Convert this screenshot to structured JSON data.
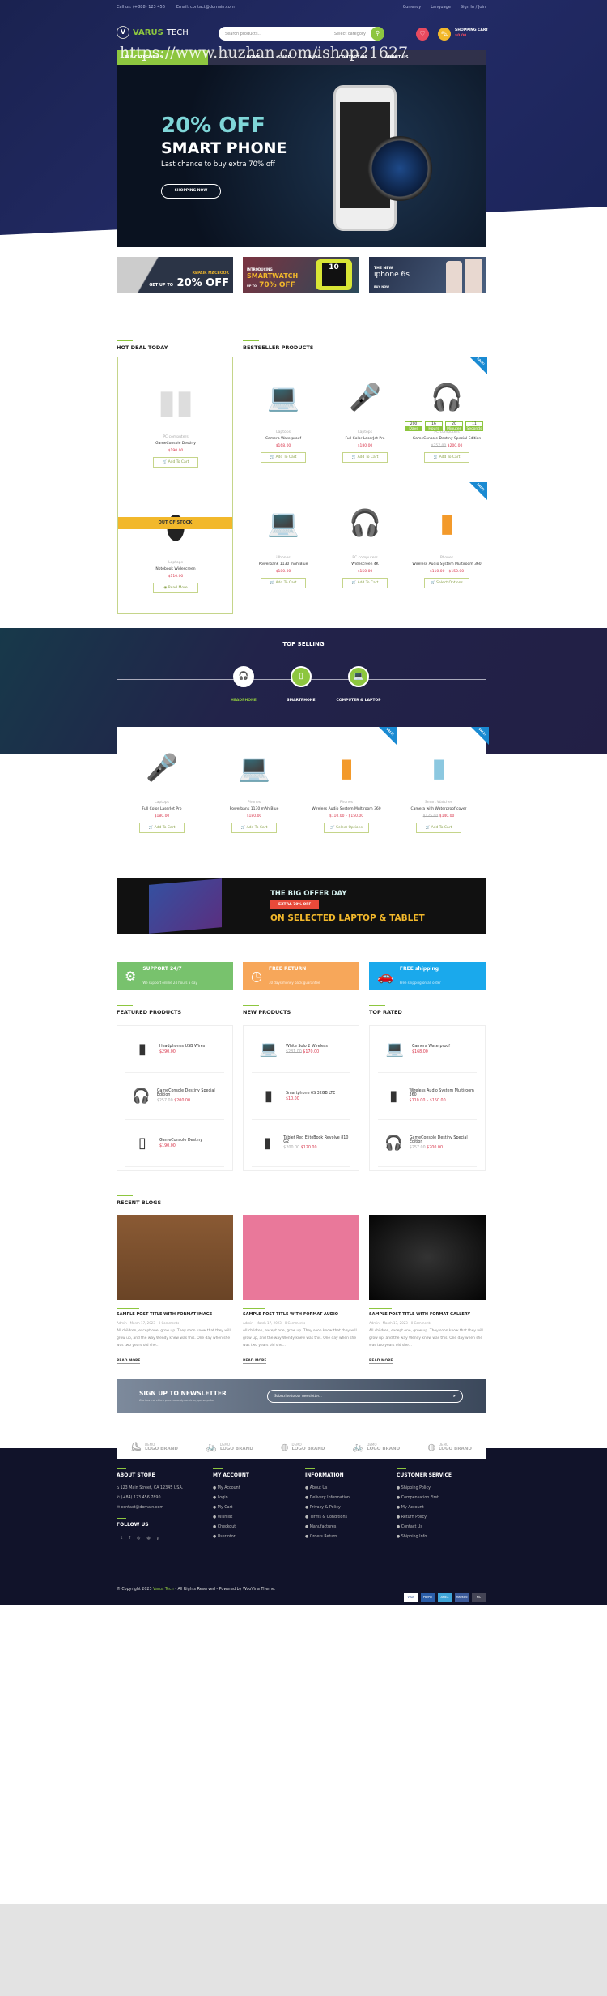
{
  "watermark": "https://www.huzhan.com/ishop21627",
  "topbar": {
    "phone": "Call us: (+888) 123 456",
    "email": "Email: contact@domain.com",
    "currency": "Currency",
    "language": "Language",
    "signin": "Sign In / Join"
  },
  "header": {
    "logo_a": "VARUS",
    "logo_b": "TECH",
    "search_placeholder": "Search products...",
    "category": "Select category",
    "cart_label": "SHOPPING CART",
    "cart_total": "$0.00",
    "wishlist_count": "0",
    "cart_count": "0"
  },
  "nav": {
    "all": "ALL CATEGORIES",
    "items": [
      "HOME",
      "SHOP",
      "BLOG",
      "CONTACT US",
      "ABOUT US"
    ]
  },
  "hero": {
    "line1": "20% OFF",
    "line2": "SMART PHONE",
    "line3": "Last chance to buy extra 70% off",
    "button": "SHOPPING NOW"
  },
  "promos": [
    {
      "small": "REPAIR MACBOOK",
      "a": "GET UP TO",
      "b": "20% OFF"
    },
    {
      "small": "INTRODUCING",
      "a": "SMARTWATCH",
      "b": "UP TO",
      "c": "70% OFF"
    },
    {
      "small": "THE NEW",
      "a": "iphone 6s",
      "b": "BUY NOW"
    }
  ],
  "hot_deal": {
    "title": "HOT DEAL TODAY",
    "items": [
      {
        "cat": "PC computers",
        "name": "GameConsole Destiny",
        "price": "$190.00",
        "btn": "Add To Cart"
      },
      {
        "cat": "Laptops",
        "name": "Notebook Widescreen",
        "price": "$110.00",
        "btn": "Read More",
        "badge": "OUT OF STOCK"
      }
    ]
  },
  "bestseller": {
    "title": "BESTSELLER PRODUCTS",
    "items": [
      {
        "cat": "Laptops",
        "name": "Camera Waterproof",
        "price": "$168.00",
        "btn": "Add To Cart"
      },
      {
        "cat": "Laptops",
        "name": "Full Color LaserJet Pro",
        "price": "$180.00",
        "btn": "Add To Cart"
      },
      {
        "cat": "PC computers",
        "name": "GameConsole Destiny Special Edition",
        "old": "$257.00",
        "price": "$200.00",
        "btn": "Add To Cart",
        "sale": "SALE!"
      },
      {
        "cat": "iPhones",
        "name": "Powerbank 1130 mAh Blue",
        "price": "$180.00",
        "btn": "Add To Cart"
      },
      {
        "cat": "PC computers",
        "name": "Widescreen 4K",
        "price": "$150.00",
        "btn": "Add To Cart"
      },
      {
        "cat": "Phones",
        "name": "Wireless Audio System Multiroom 360",
        "price": "$110.00 – $150.00",
        "btn": "Select Options",
        "sale": "SALE!"
      }
    ],
    "countdown": [
      {
        "v": "200",
        "l": "Days"
      },
      {
        "v": "16",
        "l": "Hours"
      },
      {
        "v": "20",
        "l": "Minutes"
      },
      {
        "v": "11",
        "l": "Seconds"
      }
    ]
  },
  "top_selling": {
    "title": "TOP SELLING",
    "tabs": [
      "HEADPHONE",
      "SMARTPHONE",
      "COMPUTER & LAPTOP"
    ],
    "items": [
      {
        "cat": "Laptops",
        "name": "Full Color LaserJet Pro",
        "price": "$180.00",
        "btn": "Add To Cart"
      },
      {
        "cat": "Phones",
        "name": "Powerbank 1130 mAh Blue",
        "price": "$180.00",
        "btn": "Add To Cart"
      },
      {
        "cat": "Phones",
        "name": "Wireless Audio System Multiroom 360",
        "price": "$110.00 – $150.00",
        "btn": "Select Options",
        "sale": "SALE!"
      },
      {
        "cat": "Smart Watches",
        "name": "Camera with Waterproof cover",
        "old": "$175.00",
        "price": "$140.00",
        "btn": "Add To Cart",
        "sale": "SALE!"
      }
    ]
  },
  "offer": {
    "line1": "THE BIG OFFER DAY",
    "badge": "EXTRA 70% OFF",
    "line2": "ON SELECTED LAPTOP & TABLET"
  },
  "services": [
    {
      "t": "SUPPORT 24/7",
      "s": "We support online 24 hours a day",
      "c": "#78c26d"
    },
    {
      "t": "FREE RETURN",
      "s": "30 days money back guarantee",
      "c": "#f7a75a"
    },
    {
      "t": "FREE shipping",
      "s": "Free shipping on all order",
      "c": "#1aa9ec"
    }
  ],
  "lists": [
    {
      "title": "FEATURED PRODUCTS",
      "items": [
        {
          "n": "Headphones USB Wires",
          "p": "$290.00"
        },
        {
          "n": "GameConsole Destiny Special Edition",
          "o": "$257.00",
          "p": "$200.00"
        },
        {
          "n": "GameConsole Destiny",
          "p": "$190.00"
        }
      ]
    },
    {
      "title": "NEW PRODUCTS",
      "items": [
        {
          "n": "White Solo 2 Wireless",
          "o": "$281.00",
          "p": "$170.00"
        },
        {
          "n": "Smartphone 6S 32GB LTE",
          "p": "$10.00"
        },
        {
          "n": "Tablet Red EliteBook Revolve 810 G2",
          "o": "$200.00",
          "p": "$120.00"
        }
      ]
    },
    {
      "title": "TOP RATED",
      "items": [
        {
          "n": "Camera Waterproof",
          "p": "$168.00"
        },
        {
          "n": "Wireless Audio System Multiroom 360",
          "p": "$110.00 – $150.00"
        },
        {
          "n": "GameConsole Destiny Special Edition",
          "o": "$257.00",
          "p": "$200.00"
        }
      ]
    }
  ],
  "blogs": {
    "title": "RECENT BLOGS",
    "items": [
      {
        "t": "SAMPLE POST TITLE WITH FORMAT IMAGE",
        "a": "Admin",
        "d": "March 17, 2023",
        "c": "0 Comments",
        "x": "All children, except one, grow up. They soon know that they will grow up, and the way Wendy knew was this. One day when she was two years old she...",
        "r": "READ MORE"
      },
      {
        "t": "SAMPLE POST TITLE WITH FORMAT AUDIO",
        "a": "Admin",
        "d": "March 17, 2023",
        "c": "0 Comments",
        "x": "All children, except one, grow up. They soon know that they will grow up, and the way Wendy knew was this. One day when she was two years old she...",
        "r": "READ MORE"
      },
      {
        "t": "SAMPLE POST TITLE WITH FORMAT GALLERY",
        "a": "Admin",
        "d": "March 17, 2023",
        "c": "0 Comments",
        "x": "All children, except one, grow up. They soon know that they will grow up, and the way Wendy knew was this. One day when she was two years old she...",
        "r": "READ MORE"
      }
    ]
  },
  "newsletter": {
    "title": "SIGN UP TO NEWSLETTER",
    "sub": "Claritas est etiam processus dynamicus, qui sequitur",
    "placeholder": "Subscribe to our newsletter..."
  },
  "brands": {
    "demo": "DEMO",
    "name": "LOGO BRAND"
  },
  "footer": {
    "about": {
      "title": "ABOUT STORE",
      "address": "123 Main Street, CA 12345 USA.",
      "phone": "(+84) 123 456 7890",
      "email": "contact@domain.com"
    },
    "follow": "FOLLOW US",
    "cols": [
      {
        "title": "MY ACCOUNT",
        "items": [
          "My Account",
          "Login",
          "My Cart",
          "Wishlist",
          "Checkout",
          "Userinfor"
        ]
      },
      {
        "title": "INFORMATION",
        "items": [
          "About Us",
          "Delivery Information",
          "Privacy & Policy",
          "Terms & Conditions",
          "Manufactures",
          "Orders Return"
        ]
      },
      {
        "title": "CUSTOMER SERVICE",
        "items": [
          "Shipping Policy",
          "Compensation First",
          "My Account",
          "Return Policy",
          "Contact Us",
          "Shipping Info"
        ]
      }
    ],
    "copy_a": "© Copyright 2023",
    "copy_brand": "Varus Tech",
    "copy_b": "- All Rights Reserved - Powered by WooVina Theme.",
    "payments": [
      "VISA",
      "PayPal",
      "AMEX",
      "Maestro",
      "MC"
    ]
  },
  "colors": {
    "accent": "#8dc63f",
    "price": "#d8344a",
    "dark": "#11132a",
    "sale": "#1a8ad2"
  }
}
